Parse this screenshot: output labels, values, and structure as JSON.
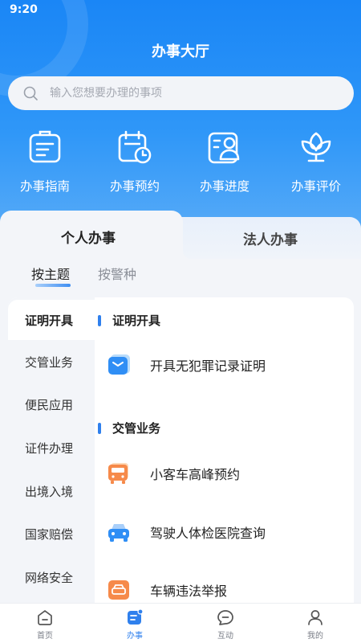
{
  "status": {
    "time": "9:20"
  },
  "header": {
    "title": "办事大厅"
  },
  "search": {
    "placeholder": "输入您想要办理的事项"
  },
  "quick_actions": [
    {
      "label": "办事指南",
      "icon": "guide-document-icon"
    },
    {
      "label": "办事预约",
      "icon": "calendar-clock-icon"
    },
    {
      "label": "办事进度",
      "icon": "progress-person-icon"
    },
    {
      "label": "办事评价",
      "icon": "flower-rating-icon"
    }
  ],
  "tabs": {
    "personal": "个人办事",
    "corporate": "法人办事",
    "active": "personal"
  },
  "subtabs": {
    "by_topic": "按主题",
    "by_police_type": "按警种",
    "active": "by_topic"
  },
  "sidebar": {
    "items": [
      "证明开具",
      "交管业务",
      "便民应用",
      "证件办理",
      "出境入境",
      "国家赔偿",
      "网络安全"
    ],
    "active": "证明开具"
  },
  "sections": [
    {
      "title": "证明开具",
      "items": [
        {
          "label": "开具无犯罪记录证明",
          "icon": "certificate-card-icon"
        }
      ]
    },
    {
      "title": "交管业务",
      "items": [
        {
          "label": "小客车高峰预约",
          "icon": "bus-icon"
        },
        {
          "label": "驾驶人体检医院查询",
          "icon": "car-icon"
        },
        {
          "label": "车辆违法举报",
          "icon": "car-report-icon"
        }
      ]
    }
  ],
  "bottom_nav": [
    {
      "label": "首页",
      "icon": "home-icon"
    },
    {
      "label": "办事",
      "icon": "service-icon"
    },
    {
      "label": "互动",
      "icon": "chat-bubble-icon"
    },
    {
      "label": "我的",
      "icon": "profile-icon"
    }
  ],
  "colors": {
    "primary": "#1a86f6",
    "accent": "#2f80ed",
    "background": "#f3f5f9"
  }
}
